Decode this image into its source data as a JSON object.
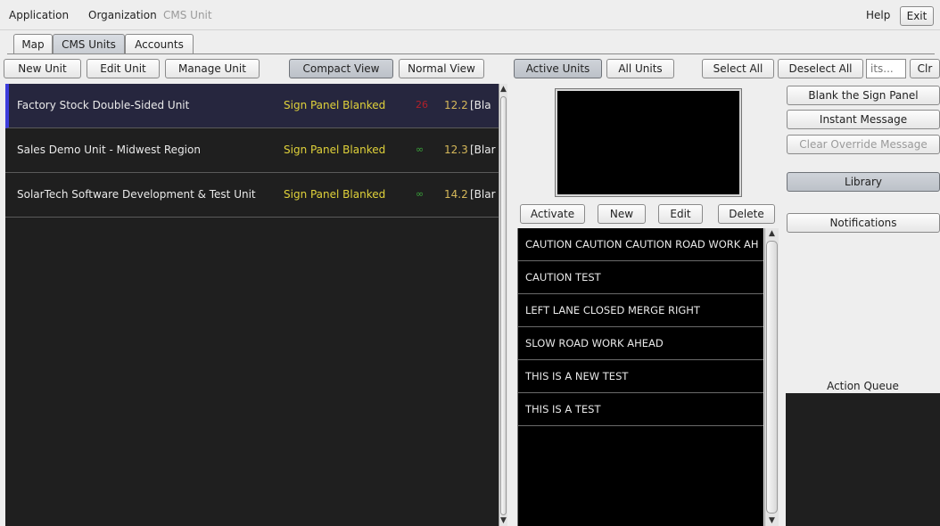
{
  "menubar": {
    "items": [
      "Application",
      "Organization",
      "CMS Unit"
    ],
    "help": "Help",
    "exit": "Exit"
  },
  "tabs": [
    "Map",
    "CMS Units",
    "Accounts"
  ],
  "toolbar": {
    "new_unit": "New Unit",
    "edit_unit": "Edit Unit",
    "manage_unit": "Manage Unit",
    "compact_view": "Compact View",
    "normal_view": "Normal View",
    "active_units": "Active Units",
    "all_units": "All Units",
    "select_all": "Select All",
    "deselect_all": "Deselect All",
    "search_placeholder": "its...",
    "clear": "Clr"
  },
  "units": [
    {
      "name": "Factory Stock Double-Sided Unit",
      "status": "Sign Panel Blanked",
      "count": "26",
      "count_color": "#b0202a",
      "voltage": "12.2",
      "extra": "[Bla"
    },
    {
      "name": "Sales Demo Unit - Midwest Region",
      "status": "Sign Panel Blanked",
      "count": "∞",
      "count_color": "#3aa33a",
      "voltage": "12.3",
      "extra": "[Blar"
    },
    {
      "name": "SolarTech Software Development & Test Unit",
      "status": "Sign Panel Blanked",
      "count": "∞",
      "count_color": "#3aa33a",
      "voltage": "14.2",
      "extra": "[Blar"
    }
  ],
  "message_actions": {
    "activate": "Activate",
    "new": "New",
    "edit": "Edit",
    "delete": "Delete"
  },
  "messages": [
    "CAUTION CAUTION CAUTION ROAD WORK AH",
    "CAUTION TEST",
    "LEFT LANE CLOSED MERGE RIGHT",
    "SLOW ROAD WORK AHEAD",
    "THIS IS A NEW TEST",
    "THIS IS A TEST"
  ],
  "side_actions": {
    "blank_sign_panel": "Blank the Sign Panel",
    "instant_message": "Instant Message",
    "clear_override": "Clear Override Message",
    "library": "Library",
    "notifications": "Notifications",
    "action_queue": "Action Queue"
  },
  "icons": {
    "scroll_up": "scroll-up-arrow",
    "scroll_down": "scroll-down-arrow"
  }
}
